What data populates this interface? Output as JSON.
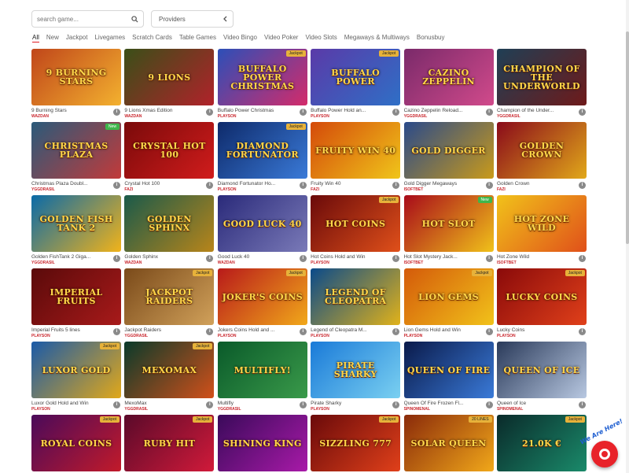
{
  "search": {
    "placeholder": "search game..."
  },
  "providers": {
    "label": "Providers"
  },
  "filters": [
    "All",
    "New",
    "Jackpot",
    "Livegames",
    "Scratch Cards",
    "Table Games",
    "Video Bingo",
    "Video Poker",
    "Video Slots",
    "Megaways & Multiways",
    "Bonusbuy"
  ],
  "active_filter": "All",
  "games": [
    {
      "thumb_text": "9 Burning Stars",
      "name": "9 Burning Stars",
      "provider": "WAZDAN",
      "badge": "",
      "bg": "#c0461a",
      "bg2": "#f3b12f"
    },
    {
      "thumb_text": "9 Lions",
      "name": "9 Lions Xmas Edition",
      "provider": "WAZDAN",
      "badge": "",
      "bg": "#3a4f18",
      "bg2": "#b1222a"
    },
    {
      "thumb_text": "Buffalo Power Christmas",
      "name": "Buffalo Power Christmas",
      "provider": "PLAYSON",
      "badge": "Jackpot",
      "bg": "#2c4fb8",
      "bg2": "#d42b6a"
    },
    {
      "thumb_text": "Buffalo Power",
      "name": "Buffalo Power Hold an...",
      "provider": "PLAYSON",
      "badge": "Jackpot",
      "bg": "#5a3aa8",
      "bg2": "#2f6fc6"
    },
    {
      "thumb_text": "Cazino Zeppelin",
      "name": "Cazino Zeppelin Reload...",
      "provider": "YGGDRASIL",
      "badge": "",
      "bg": "#7a2a6a",
      "bg2": "#d14a8b"
    },
    {
      "thumb_text": "Champion of the Underworld",
      "name": "Champion of the Under...",
      "provider": "YGGDRASIL",
      "badge": "",
      "bg": "#1f3f55",
      "bg2": "#6e1a1a"
    },
    {
      "thumb_text": "Christmas Plaza",
      "name": "Christmas Plaza Doubl...",
      "provider": "YGGDRASIL",
      "badge": "New",
      "bg": "#2a5a7a",
      "bg2": "#c23a3a"
    },
    {
      "thumb_text": "Crystal Hot 100",
      "name": "Crystal Hot 100",
      "provider": "FAZI",
      "badge": "",
      "bg": "#7a0a0a",
      "bg2": "#d11c1c"
    },
    {
      "thumb_text": "Diamond Fortunator",
      "name": "Diamond Fortunator Ho...",
      "provider": "PLAYSON",
      "badge": "Jackpot",
      "bg": "#0e2a6a",
      "bg2": "#3a7ad8"
    },
    {
      "thumb_text": "Fruity Win 40",
      "name": "Fruity Win 40",
      "provider": "FAZI",
      "badge": "",
      "bg": "#d44a0a",
      "bg2": "#f0c51a"
    },
    {
      "thumb_text": "Gold Digger",
      "name": "Gold Digger Megaways",
      "provider": "ISOFTBET",
      "badge": "",
      "bg": "#2a4a8a",
      "bg2": "#c99a1a"
    },
    {
      "thumb_text": "Golden Crown",
      "name": "Golden Crown",
      "provider": "FAZI",
      "badge": "",
      "bg": "#8a0a1a",
      "bg2": "#e1a81a"
    },
    {
      "thumb_text": "Golden Fish Tank 2",
      "name": "Golden FishTank 2 Giga...",
      "provider": "YGGDRASIL",
      "badge": "",
      "bg": "#0a6aa8",
      "bg2": "#f1b31a"
    },
    {
      "thumb_text": "Golden Sphinx",
      "name": "Golden Sphinx",
      "provider": "WAZDAN",
      "badge": "",
      "bg": "#1a5a4a",
      "bg2": "#b8851a"
    },
    {
      "thumb_text": "Good Luck 40",
      "name": "Good Luck 40",
      "provider": "WAZDAN",
      "badge": "",
      "bg": "#2a2a7a",
      "bg2": "#7a7ab8"
    },
    {
      "thumb_text": "Hot Coins",
      "name": "Hot Coins Hold and Win",
      "provider": "PLAYSON",
      "badge": "Jackpot",
      "bg": "#6a0a0a",
      "bg2": "#e0501a"
    },
    {
      "thumb_text": "Hot Slot",
      "name": "Hot Slot Mystery Jack...",
      "provider": "ISOFTBET",
      "badge": "New",
      "bg": "#a80a1a",
      "bg2": "#f0c21a"
    },
    {
      "thumb_text": "Hot Zone Wild",
      "name": "Hot Zone Wild",
      "provider": "ISOFTBET",
      "badge": "",
      "bg": "#f1c21a",
      "bg2": "#e0501a"
    },
    {
      "thumb_text": "Imperial Fruits",
      "name": "Imperial Fruits 5 lines",
      "provider": "PLAYSON",
      "badge": "",
      "bg": "#5a0a0a",
      "bg2": "#a81a1a"
    },
    {
      "thumb_text": "Jackpot Raiders",
      "name": "Jackpot Raiders",
      "provider": "YGGDRASIL",
      "badge": "Jackpot",
      "bg": "#7a4a1a",
      "bg2": "#d1a15a"
    },
    {
      "thumb_text": "Joker's Coins",
      "name": "Jokers Coins Hold and ...",
      "provider": "PLAYSON",
      "badge": "Jackpot",
      "bg": "#b81a1a",
      "bg2": "#f1a81a"
    },
    {
      "thumb_text": "Legend of Cleopatra",
      "name": "Legend of Cleopatra M...",
      "provider": "PLAYSON",
      "badge": "",
      "bg": "#0a4a8a",
      "bg2": "#e1b21a"
    },
    {
      "thumb_text": "Lion Gems",
      "name": "Lion Gems Hold and Win",
      "provider": "PLAYSON",
      "badge": "Jackpot",
      "bg": "#d45a0a",
      "bg2": "#f1c21a"
    },
    {
      "thumb_text": "Lucky Coins",
      "name": "Lucky Coins",
      "provider": "PLAYSON",
      "badge": "Jackpot",
      "bg": "#8a0a0a",
      "bg2": "#e0401a"
    },
    {
      "thumb_text": "Luxor Gold",
      "name": "Luxor Gold Hold and Win",
      "provider": "PLAYSON",
      "badge": "Jackpot",
      "bg": "#1a5aa8",
      "bg2": "#e1a81a"
    },
    {
      "thumb_text": "MexoMax",
      "name": "MexoMax",
      "provider": "YGGDRASIL",
      "badge": "Jackpot",
      "bg": "#0a3a2a",
      "bg2": "#d1501a"
    },
    {
      "thumb_text": "Multifly!",
      "name": "Multifly",
      "provider": "YGGDRASIL",
      "badge": "",
      "bg": "#0a5a2a",
      "bg2": "#3a9a4a"
    },
    {
      "thumb_text": "Pirate Sharky",
      "name": "Pirate Sharky",
      "provider": "PLAYSON",
      "badge": "",
      "bg": "#1a7ad8",
      "bg2": "#7ad0f1"
    },
    {
      "thumb_text": "Queen of Fire",
      "name": "Queen Of Fire Frozen Fl...",
      "provider": "SPINOMENAL",
      "badge": "",
      "bg": "#0a1a4a",
      "bg2": "#3a7ad8"
    },
    {
      "thumb_text": "Queen of Ice",
      "name": "Queen of Ice",
      "provider": "SPINOMENAL",
      "badge": "",
      "bg": "#2a3a5a",
      "bg2": "#b8c8e1"
    },
    {
      "thumb_text": "Royal Coins",
      "name": "",
      "provider": "",
      "badge": "Jackpot",
      "bg": "#4a0a5a",
      "bg2": "#c21a2a"
    },
    {
      "thumb_text": "Ruby Hit",
      "name": "",
      "provider": "",
      "badge": "Jackpot",
      "bg": "#5a0a2a",
      "bg2": "#d11a3a"
    },
    {
      "thumb_text": "Shining King",
      "name": "",
      "provider": "",
      "badge": "",
      "bg": "#3a0a5a",
      "bg2": "#a81aa8"
    },
    {
      "thumb_text": "Sizzling 777",
      "name": "",
      "provider": "",
      "badge": "Jackpot",
      "bg": "#6a0a0a",
      "bg2": "#e0401a"
    },
    {
      "thumb_text": "Solar Queen",
      "name": "",
      "provider": "",
      "badge": "20 LINES",
      "bg": "#8a2a0a",
      "bg2": "#f1a81a"
    },
    {
      "thumb_text": "21.0k €",
      "name": "",
      "provider": "",
      "badge": "Jackpot",
      "bg": "#0a2a2a",
      "bg2": "#1a8a6a"
    }
  ],
  "chat": {
    "callout": "We Are Here!"
  },
  "colors": {
    "accent": "#e01c24",
    "badge_jackpot": "#e7b23a",
    "badge_new": "#3fb64b"
  },
  "icons": {
    "search": "search-icon",
    "providers_toggle": "chevron-left-icon",
    "info": "info-icon",
    "chat": "chat-icon"
  }
}
